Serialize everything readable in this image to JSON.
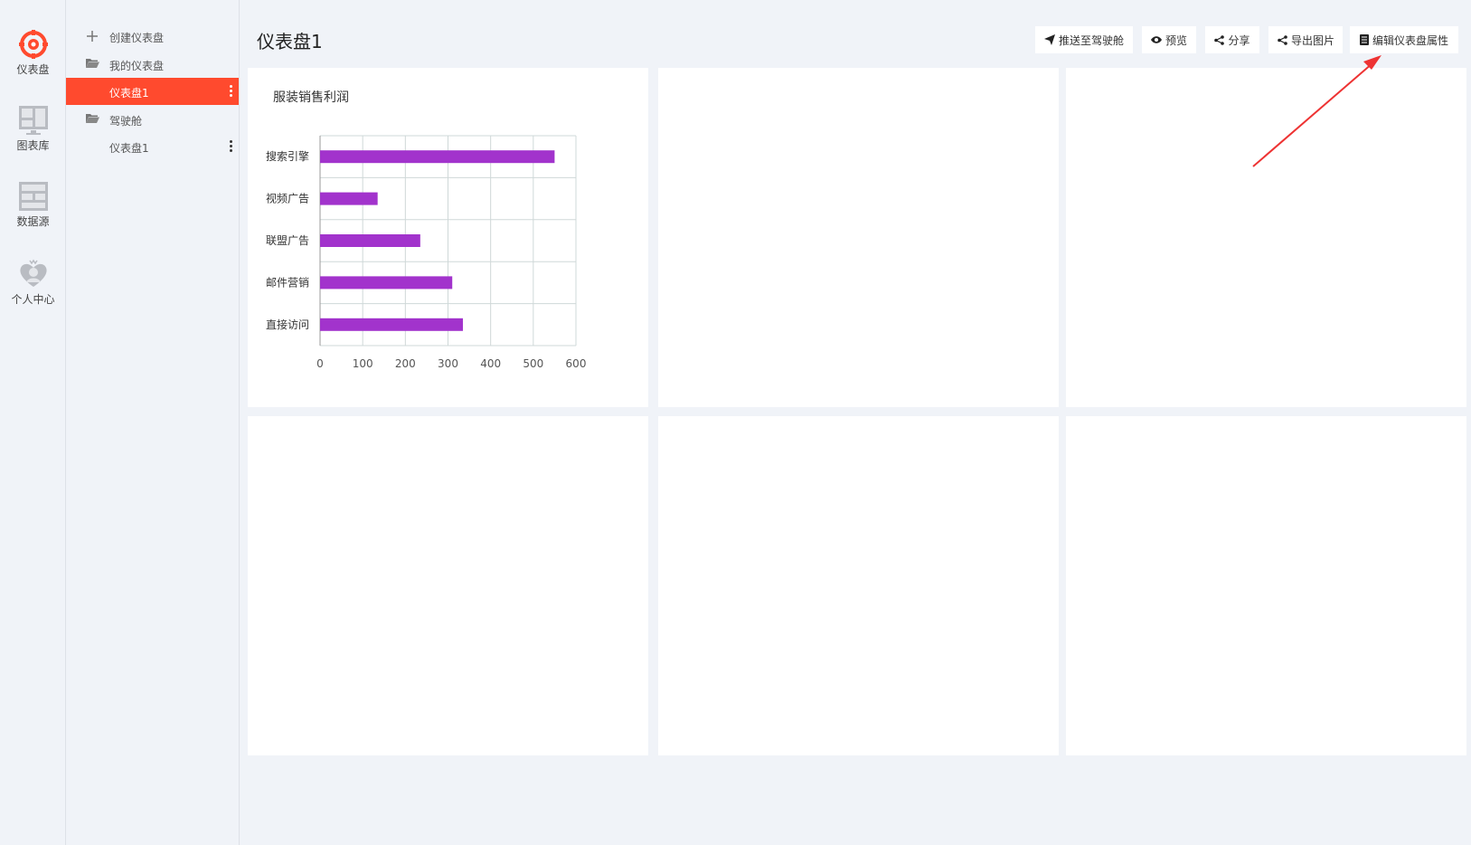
{
  "rail": {
    "items": [
      {
        "label": "仪表盘",
        "icon": "dashboard-gear-icon"
      },
      {
        "label": "图表库",
        "icon": "chart-library-icon"
      },
      {
        "label": "数据源",
        "icon": "datasource-icon"
      },
      {
        "label": "个人中心",
        "icon": "heart-user-icon"
      }
    ]
  },
  "tree": {
    "create_label": "创建仪表盘",
    "folder_mine": "我的仪表盘",
    "item_selected": "仪表盘1",
    "folder_cockpit": "驾驶舱",
    "item_cockpit": "仪表盘1"
  },
  "header": {
    "title": "仪表盘1"
  },
  "toolbar": {
    "push_label": "推送至驾驶舱",
    "preview_label": "预览",
    "share_label": "分享",
    "export_label": "导出图片",
    "edit_label": "编辑仪表盘属性"
  },
  "colors": {
    "accent": "#ff4a2e",
    "bar": "#a233cc",
    "arrow": "#ee3333"
  },
  "chart_data": {
    "type": "bar",
    "orientation": "horizontal",
    "title": "服装销售利润",
    "categories": [
      "搜索引擎",
      "视频广告",
      "联盟广告",
      "邮件营销",
      "直接访问"
    ],
    "values": [
      550,
      135,
      235,
      310,
      335
    ],
    "xlim": [
      0,
      600
    ],
    "xticks": [
      0,
      100,
      200,
      300,
      400,
      500,
      600
    ],
    "grid": true,
    "xlabel": "",
    "ylabel": ""
  }
}
